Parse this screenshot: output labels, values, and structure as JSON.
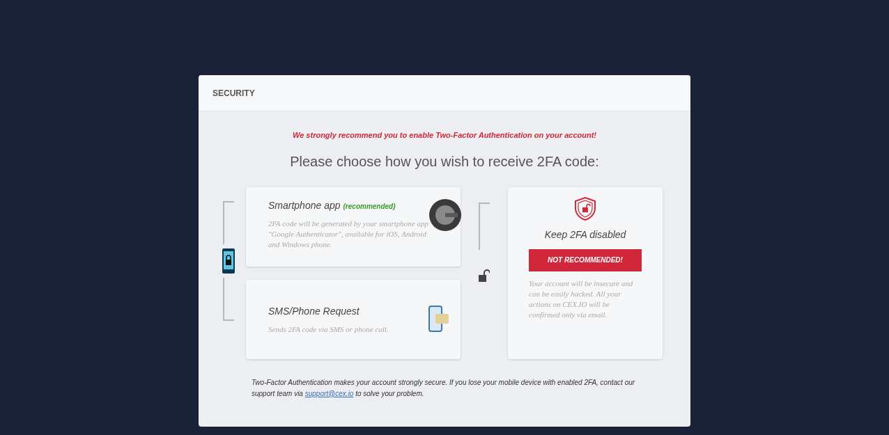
{
  "dialog": {
    "title": "SECURITY"
  },
  "warning": "We strongly recommend you to enable Two-Factor Authentication on your account!",
  "heading": "Please choose how you wish to receive 2FA code:",
  "options": [
    {
      "kind": "app",
      "title": "Smartphone app",
      "badge": "(recommended)",
      "description": "2FA code will be generated by your smartphone app \"Google Authenticator\", available for iOS, Android and Windows phone."
    },
    {
      "kind": "sms",
      "title": "SMS/Phone Request",
      "description": "Sends 2FA code via SMS or phone call."
    }
  ],
  "disable_option": {
    "title": "Keep 2FA disabled",
    "button": "NOT RECOMMENDED!",
    "description": "Your account will be insecure and can be easily hacked. All your actions on CEX.IO will be confirmed only via email."
  },
  "footer": {
    "text_before": "Two-Factor Authentication makes your account strongly secure. If you lose your mobile device with enabled 2FA, contact our support team via ",
    "link": "support@cex.io",
    "text_after": " to solve your problem."
  }
}
